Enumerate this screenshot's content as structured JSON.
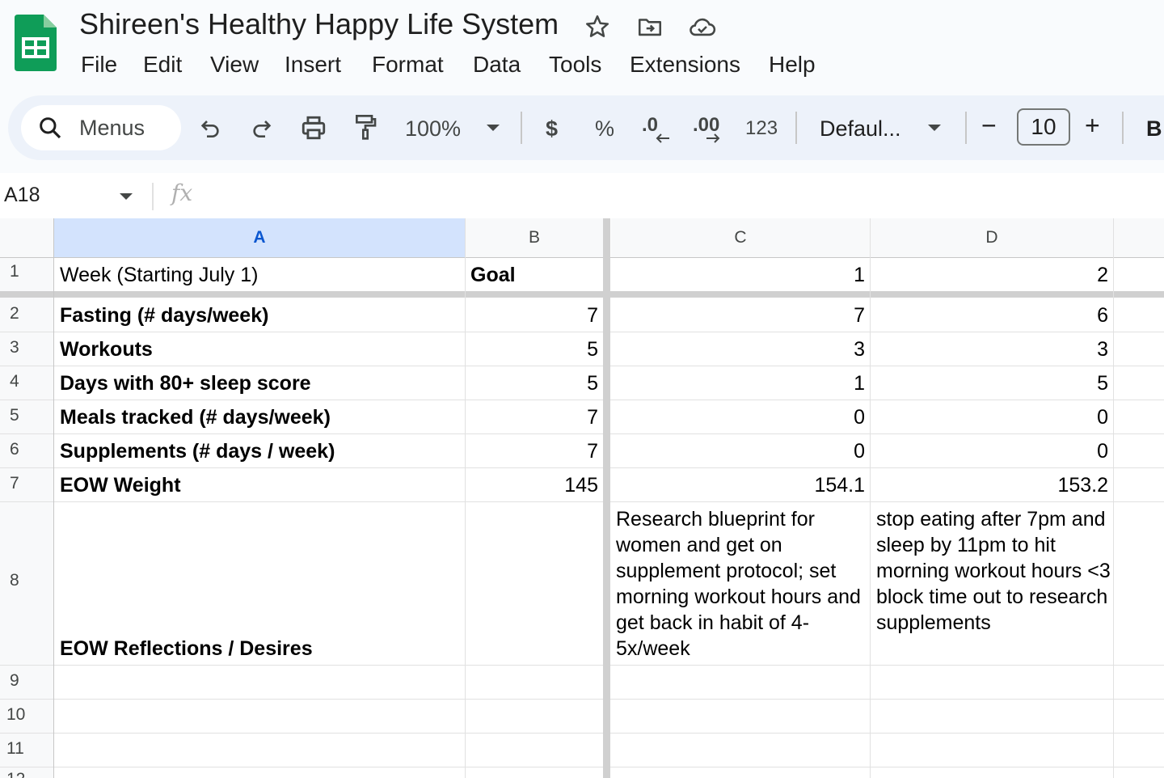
{
  "app": {
    "doc_title": "Shireen's Healthy Happy Life System",
    "accent_color": "#0f9d58",
    "menus": [
      "File",
      "Edit",
      "View",
      "Insert",
      "Format",
      "Data",
      "Tools",
      "Extensions",
      "Help"
    ]
  },
  "toolbar": {
    "search_label": "Menus",
    "zoom": "100%",
    "currency": "$",
    "percent": "%",
    "decrease_decimal": ".0",
    "increase_decimal": ".00",
    "number_format": "123",
    "font": "Defaul...",
    "minus": "−",
    "font_size": "10",
    "plus": "+",
    "bold": "B"
  },
  "formula_bar": {
    "cell_ref": "A18",
    "fx": "fx"
  },
  "sheet": {
    "columns": [
      "A",
      "B",
      "C",
      "D"
    ],
    "row_numbers": [
      "1",
      "2",
      "3",
      "4",
      "5",
      "6",
      "7",
      "8",
      "9",
      "10",
      "11",
      "12"
    ],
    "rows": [
      {
        "a": "Week (Starting July 1)",
        "b": "Goal",
        "c": "1",
        "d": "2"
      },
      {
        "a": "Fasting (# days/week)",
        "b": "7",
        "c": "7",
        "d": "6"
      },
      {
        "a": "Workouts",
        "b": "5",
        "c": "3",
        "d": "3"
      },
      {
        "a": "Days with 80+ sleep score",
        "b": "5",
        "c": "1",
        "d": "5"
      },
      {
        "a": "Meals tracked (# days/week)",
        "b": "7",
        "c": "0",
        "d": "0"
      },
      {
        "a": "Supplements (# days / week)",
        "b": "7",
        "c": "0",
        "d": "0"
      },
      {
        "a": "EOW Weight",
        "b": "145",
        "c": "154.1",
        "d": "153.2"
      },
      {
        "a": "EOW Reflections / Desires",
        "b": "",
        "c": "Research blueprint for women and get on supplement protocol; set morning workout hours and get back in habit of 4-5x/week",
        "d": "stop eating after 7pm and sleep by 11pm to hit morning workout hours <3 block time out to research supplements"
      }
    ]
  }
}
